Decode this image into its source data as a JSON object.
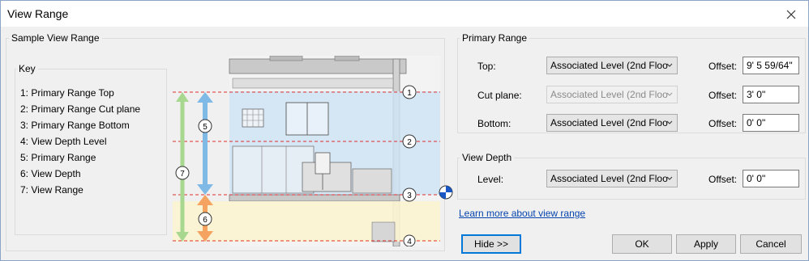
{
  "window": {
    "title": "View Range"
  },
  "sample": {
    "group_label": "Sample View Range",
    "key_title": "Key",
    "key_items": [
      "1: Primary Range Top",
      "2: Primary Range Cut plane",
      "3: Primary Range Bottom",
      "4: View Depth Level",
      "5: Primary Range",
      "6: View Depth",
      "7: View Range"
    ],
    "diagram_markers": [
      "1",
      "2",
      "3",
      "4",
      "5",
      "6",
      "7"
    ]
  },
  "primary_range": {
    "group_label": "Primary Range",
    "top": {
      "label": "Top:",
      "level": "Associated Level (2nd Floo",
      "offset_label": "Offset:",
      "offset": "9'  5 59/64\""
    },
    "cut_plane": {
      "label": "Cut plane:",
      "level": "Associated Level (2nd Floo",
      "offset_label": "Offset:",
      "offset": "3'  0\""
    },
    "bottom": {
      "label": "Bottom:",
      "level": "Associated Level (2nd Floo",
      "offset_label": "Offset:",
      "offset": "0'  0\""
    }
  },
  "view_depth": {
    "group_label": "View Depth",
    "level": {
      "label": "Level:",
      "level": "Associated Level (2nd Floo",
      "offset_label": "Offset:",
      "offset": "0'  0\""
    }
  },
  "learn_more": "Learn more about view range",
  "buttons": {
    "hide": "Hide >>",
    "ok": "OK",
    "apply": "Apply",
    "cancel": "Cancel"
  },
  "colors": {
    "accent": "#0078d7",
    "range_green": "#a8d88f",
    "range_blue": "#7fb9e6",
    "depth_orange": "#f4a460",
    "cut_red": "#e03030"
  }
}
